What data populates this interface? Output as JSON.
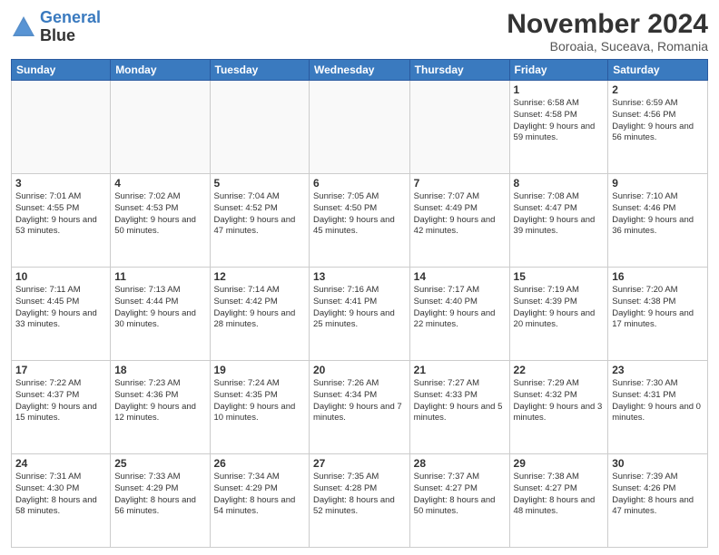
{
  "header": {
    "logo_line1": "General",
    "logo_line2": "Blue",
    "month_title": "November 2024",
    "location": "Boroaia, Suceava, Romania"
  },
  "weekdays": [
    "Sunday",
    "Monday",
    "Tuesday",
    "Wednesday",
    "Thursday",
    "Friday",
    "Saturday"
  ],
  "weeks": [
    [
      {
        "day": "",
        "info": ""
      },
      {
        "day": "",
        "info": ""
      },
      {
        "day": "",
        "info": ""
      },
      {
        "day": "",
        "info": ""
      },
      {
        "day": "",
        "info": ""
      },
      {
        "day": "1",
        "info": "Sunrise: 6:58 AM\nSunset: 4:58 PM\nDaylight: 9 hours and 59 minutes."
      },
      {
        "day": "2",
        "info": "Sunrise: 6:59 AM\nSunset: 4:56 PM\nDaylight: 9 hours and 56 minutes."
      }
    ],
    [
      {
        "day": "3",
        "info": "Sunrise: 7:01 AM\nSunset: 4:55 PM\nDaylight: 9 hours and 53 minutes."
      },
      {
        "day": "4",
        "info": "Sunrise: 7:02 AM\nSunset: 4:53 PM\nDaylight: 9 hours and 50 minutes."
      },
      {
        "day": "5",
        "info": "Sunrise: 7:04 AM\nSunset: 4:52 PM\nDaylight: 9 hours and 47 minutes."
      },
      {
        "day": "6",
        "info": "Sunrise: 7:05 AM\nSunset: 4:50 PM\nDaylight: 9 hours and 45 minutes."
      },
      {
        "day": "7",
        "info": "Sunrise: 7:07 AM\nSunset: 4:49 PM\nDaylight: 9 hours and 42 minutes."
      },
      {
        "day": "8",
        "info": "Sunrise: 7:08 AM\nSunset: 4:47 PM\nDaylight: 9 hours and 39 minutes."
      },
      {
        "day": "9",
        "info": "Sunrise: 7:10 AM\nSunset: 4:46 PM\nDaylight: 9 hours and 36 minutes."
      }
    ],
    [
      {
        "day": "10",
        "info": "Sunrise: 7:11 AM\nSunset: 4:45 PM\nDaylight: 9 hours and 33 minutes."
      },
      {
        "day": "11",
        "info": "Sunrise: 7:13 AM\nSunset: 4:44 PM\nDaylight: 9 hours and 30 minutes."
      },
      {
        "day": "12",
        "info": "Sunrise: 7:14 AM\nSunset: 4:42 PM\nDaylight: 9 hours and 28 minutes."
      },
      {
        "day": "13",
        "info": "Sunrise: 7:16 AM\nSunset: 4:41 PM\nDaylight: 9 hours and 25 minutes."
      },
      {
        "day": "14",
        "info": "Sunrise: 7:17 AM\nSunset: 4:40 PM\nDaylight: 9 hours and 22 minutes."
      },
      {
        "day": "15",
        "info": "Sunrise: 7:19 AM\nSunset: 4:39 PM\nDaylight: 9 hours and 20 minutes."
      },
      {
        "day": "16",
        "info": "Sunrise: 7:20 AM\nSunset: 4:38 PM\nDaylight: 9 hours and 17 minutes."
      }
    ],
    [
      {
        "day": "17",
        "info": "Sunrise: 7:22 AM\nSunset: 4:37 PM\nDaylight: 9 hours and 15 minutes."
      },
      {
        "day": "18",
        "info": "Sunrise: 7:23 AM\nSunset: 4:36 PM\nDaylight: 9 hours and 12 minutes."
      },
      {
        "day": "19",
        "info": "Sunrise: 7:24 AM\nSunset: 4:35 PM\nDaylight: 9 hours and 10 minutes."
      },
      {
        "day": "20",
        "info": "Sunrise: 7:26 AM\nSunset: 4:34 PM\nDaylight: 9 hours and 7 minutes."
      },
      {
        "day": "21",
        "info": "Sunrise: 7:27 AM\nSunset: 4:33 PM\nDaylight: 9 hours and 5 minutes."
      },
      {
        "day": "22",
        "info": "Sunrise: 7:29 AM\nSunset: 4:32 PM\nDaylight: 9 hours and 3 minutes."
      },
      {
        "day": "23",
        "info": "Sunrise: 7:30 AM\nSunset: 4:31 PM\nDaylight: 9 hours and 0 minutes."
      }
    ],
    [
      {
        "day": "24",
        "info": "Sunrise: 7:31 AM\nSunset: 4:30 PM\nDaylight: 8 hours and 58 minutes."
      },
      {
        "day": "25",
        "info": "Sunrise: 7:33 AM\nSunset: 4:29 PM\nDaylight: 8 hours and 56 minutes."
      },
      {
        "day": "26",
        "info": "Sunrise: 7:34 AM\nSunset: 4:29 PM\nDaylight: 8 hours and 54 minutes."
      },
      {
        "day": "27",
        "info": "Sunrise: 7:35 AM\nSunset: 4:28 PM\nDaylight: 8 hours and 52 minutes."
      },
      {
        "day": "28",
        "info": "Sunrise: 7:37 AM\nSunset: 4:27 PM\nDaylight: 8 hours and 50 minutes."
      },
      {
        "day": "29",
        "info": "Sunrise: 7:38 AM\nSunset: 4:27 PM\nDaylight: 8 hours and 48 minutes."
      },
      {
        "day": "30",
        "info": "Sunrise: 7:39 AM\nSunset: 4:26 PM\nDaylight: 8 hours and 47 minutes."
      }
    ]
  ]
}
